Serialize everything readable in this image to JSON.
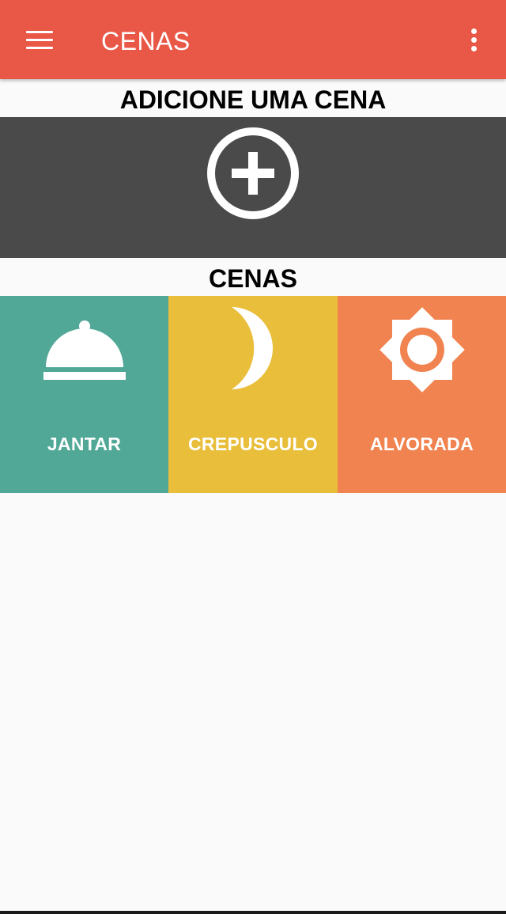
{
  "appbar": {
    "title": "CENAS",
    "menu_icon": "hamburger-menu-icon",
    "overflow_icon": "more-vertical-icon",
    "color": "#e95746"
  },
  "add_section": {
    "heading": "ADICIONE UMA CENA",
    "icon": "add-circle-icon",
    "panel_color": "#4a4a4a"
  },
  "scenes_section": {
    "heading": "CENAS",
    "items": [
      {
        "label": "JANTAR",
        "icon": "food-cloche-icon",
        "color": "#52a897"
      },
      {
        "label": "CREPUSCULO",
        "icon": "crescent-moon-icon",
        "color": "#e8be3a"
      },
      {
        "label": "ALVORADA",
        "icon": "sun-icon",
        "color": "#f0834f"
      }
    ]
  }
}
